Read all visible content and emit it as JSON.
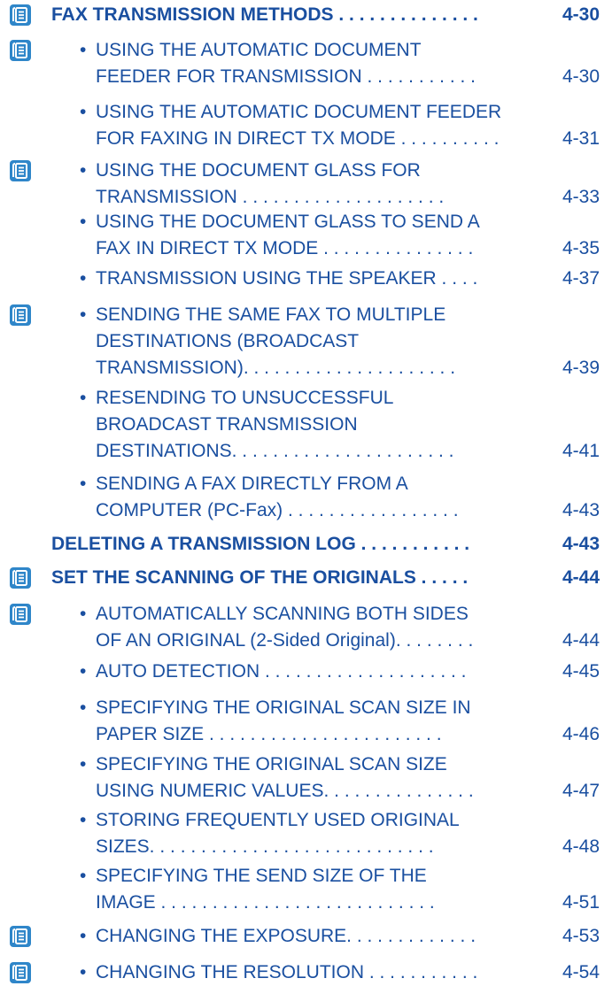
{
  "entries": [
    {
      "kind": "heading",
      "icon": "book-icon",
      "lines": [
        "FAX TRANSMISSION METHODS . . . . . . . . . . . . . ."
      ],
      "page": "4-30"
    },
    {
      "kind": "sub",
      "icon": "book-icon",
      "lines": [
        "USING THE AUTOMATIC DOCUMENT",
        "FEEDER FOR TRANSMISSION . . . . . . . . . . ."
      ],
      "page": "4-30"
    },
    {
      "kind": "sub",
      "icon": "",
      "lines": [
        "USING THE AUTOMATIC DOCUMENT FEEDER",
        "FOR FAXING IN DIRECT TX MODE . . . . . . . . . ."
      ],
      "page": "4-31"
    },
    {
      "kind": "sub",
      "icon": "book-icon",
      "lines": [
        "USING THE DOCUMENT GLASS FOR",
        "TRANSMISSION . . . . . . . . . . . . . . . . . . . ."
      ],
      "page": "4-33"
    },
    {
      "kind": "sub",
      "icon": "",
      "lines": [
        "USING THE DOCUMENT GLASS TO SEND A",
        "FAX IN DIRECT TX MODE . . . . . . . . . . . . . . ."
      ],
      "page": "4-35"
    },
    {
      "kind": "sub",
      "icon": "",
      "lines": [
        "TRANSMISSION USING THE SPEAKER . . . ."
      ],
      "page": "4-37"
    },
    {
      "kind": "sub",
      "icon": "book-icon",
      "lines": [
        "SENDING THE SAME FAX TO MULTIPLE",
        "DESTINATIONS (BROADCAST",
        "TRANSMISSION). . . . . . . . . . . . . . . . . . . . ."
      ],
      "page": "4-39"
    },
    {
      "kind": "sub",
      "icon": "",
      "lines": [
        "RESENDING TO UNSUCCESSFUL",
        "BROADCAST TRANSMISSION",
        "DESTINATIONS. . . . . . . . . . . . . . . . . . . . . ."
      ],
      "page": "4-41"
    },
    {
      "kind": "sub",
      "icon": "",
      "lines": [
        "SENDING A FAX DIRECTLY FROM A",
        "COMPUTER (PC-Fax) . . . . . . . . . . . . . . . . ."
      ],
      "page": "4-43"
    },
    {
      "kind": "heading",
      "icon": "",
      "lines": [
        "DELETING A TRANSMISSION LOG . . . . . . . . . . ."
      ],
      "page": "4-43"
    },
    {
      "kind": "heading",
      "icon": "book-icon",
      "lines": [
        "SET THE SCANNING OF THE ORIGINALS . . . . ."
      ],
      "page": "4-44"
    },
    {
      "kind": "sub",
      "icon": "book-icon",
      "lines": [
        "AUTOMATICALLY SCANNING BOTH SIDES",
        "OF AN ORIGINAL (2-Sided Original). . . . . . . ."
      ],
      "page": "4-44"
    },
    {
      "kind": "sub",
      "icon": "",
      "lines": [
        "AUTO DETECTION . . . . . . . . . . . . . . . . . . . ."
      ],
      "page": "4-45"
    },
    {
      "kind": "sub",
      "icon": "",
      "lines": [
        "SPECIFYING THE ORIGINAL SCAN SIZE IN",
        "PAPER SIZE . . . . . . . . . . . . . . . . . . . . . . ."
      ],
      "page": "4-46"
    },
    {
      "kind": "sub",
      "icon": "",
      "lines": [
        "SPECIFYING THE ORIGINAL SCAN SIZE",
        "USING NUMERIC VALUES. . . . . . . . . . . . . . ."
      ],
      "page": "4-47"
    },
    {
      "kind": "sub",
      "icon": "",
      "lines": [
        "STORING FREQUENTLY USED ORIGINAL",
        "SIZES. . . . . . . . . . . . . . . . . . . . . . . . . . . ."
      ],
      "page": "4-48"
    },
    {
      "kind": "sub",
      "icon": "",
      "lines": [
        "SPECIFYING THE SEND SIZE OF THE",
        "IMAGE . . . . . . . . . . . . . . . . . . . . . . . . . . ."
      ],
      "page": "4-51"
    },
    {
      "kind": "sub",
      "icon": "book-icon",
      "lines": [
        "CHANGING THE EXPOSURE. . . . . . . . . . . . ."
      ],
      "page": "4-53"
    },
    {
      "kind": "sub",
      "icon": "book-icon",
      "lines": [
        "CHANGING THE RESOLUTION . . . . . . . . . . ."
      ],
      "page": "4-54"
    }
  ],
  "colors": {
    "text": "#1a4fa0",
    "icon_bg": "#2f86c9",
    "icon_fg": "#ffffff"
  }
}
